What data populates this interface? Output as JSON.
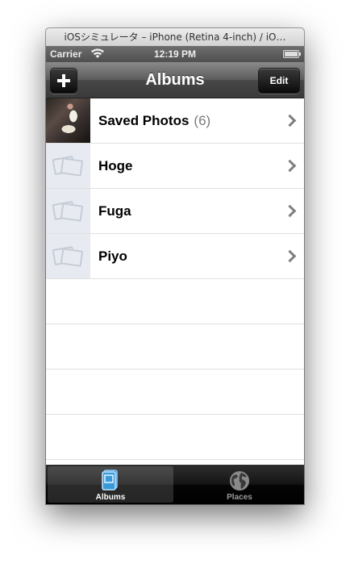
{
  "window": {
    "title": "iOSシミュレータ – iPhone (Retina 4-inch) / iO…"
  },
  "status_bar": {
    "carrier": "Carrier",
    "time": "12:19 PM"
  },
  "nav_bar": {
    "title": "Albums",
    "edit_label": "Edit"
  },
  "albums": [
    {
      "name": "Saved Photos",
      "count": "(6)"
    },
    {
      "name": "Hoge"
    },
    {
      "name": "Fuga"
    },
    {
      "name": "Piyo"
    }
  ],
  "tabs": [
    {
      "label": "Albums",
      "icon": "albums-icon",
      "selected": true
    },
    {
      "label": "Places",
      "icon": "globe-icon",
      "selected": false
    }
  ],
  "colors": {
    "tab_selected_icon": "#3a9ad9",
    "nav_bar": "#4a4a4a"
  }
}
